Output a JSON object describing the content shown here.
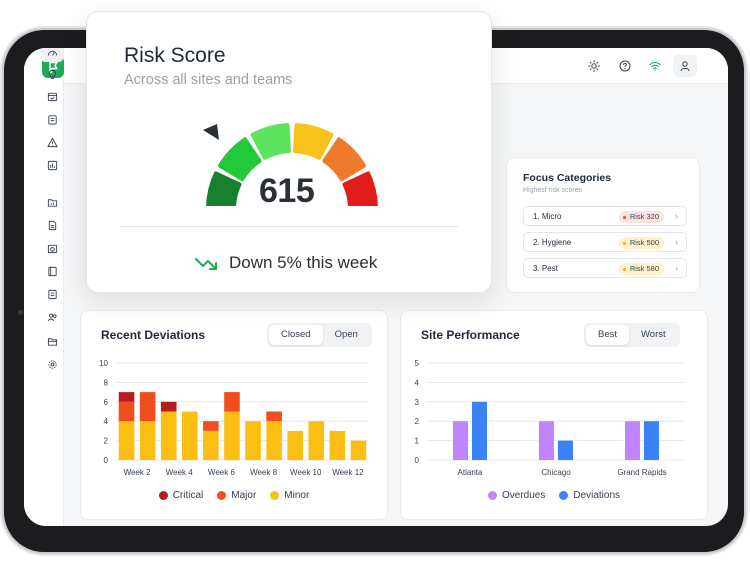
{
  "colors": {
    "brand": "#1faa58",
    "critical": "#b91c1c",
    "major": "#f04e1e",
    "minor": "#fbbf14",
    "overdues": "#c084fc",
    "deviations": "#3b82f6",
    "trend": "#1faa58",
    "gauge": [
      "#17812f",
      "#23c93a",
      "#5fe35f",
      "#f8c21c",
      "#f07a2b",
      "#e21b1b"
    ]
  },
  "sidebar": {
    "icons": [
      "gauge-icon",
      "lightbulb-icon",
      "calendar-check-icon",
      "clipboard-icon",
      "warning-icon",
      "bar-chart-icon",
      "folder-chart-icon",
      "document-icon",
      "calendar-clock-icon",
      "book-icon",
      "notes-icon",
      "users-icon",
      "folder-open-icon",
      "settings-icon"
    ]
  },
  "topbar": {
    "icons": [
      "sun-icon",
      "help-icon",
      "wifi-icon",
      "user-icon"
    ]
  },
  "risk": {
    "title": "Risk Score",
    "subtitle": "Across all sites and teams",
    "score": "615",
    "trend": "Down 5% this week"
  },
  "focus": {
    "title": "Focus Categories",
    "subtitle": "Highest risk scores",
    "items": [
      {
        "label": "1. Micro",
        "risk": "Risk 320",
        "level": "red"
      },
      {
        "label": "2. Hygiene",
        "risk": "Risk 500",
        "level": "yellow"
      },
      {
        "label": "3. Pest",
        "risk": "Risk 580",
        "level": "yellow"
      }
    ]
  },
  "deviations": {
    "title": "Recent Deviations",
    "toggle": [
      "Closed",
      "Open"
    ],
    "active_toggle": "Closed",
    "legend": [
      "Critical",
      "Major",
      "Minor"
    ]
  },
  "performance": {
    "title": "Site Performance",
    "toggle": [
      "Best",
      "Worst"
    ],
    "active_toggle": "Best",
    "legend": [
      "Overdues",
      "Deviations"
    ]
  },
  "chart_data": [
    {
      "type": "bar",
      "stacked": true,
      "title": "Recent Deviations",
      "categories": [
        "Week 1",
        "Week 2",
        "Week 3",
        "Week 4",
        "Week 5",
        "Week 6",
        "Week 7",
        "Week 8",
        "Week 9",
        "Week 10",
        "Week 11",
        "Week 12"
      ],
      "tick_labels_shown": [
        "Week 2",
        "Week 4",
        "Week 6",
        "Week 8",
        "Week 10",
        "Week 12"
      ],
      "series": [
        {
          "name": "Minor",
          "values": [
            4,
            4,
            5,
            5,
            3,
            5,
            4,
            4,
            3,
            4,
            3,
            2
          ]
        },
        {
          "name": "Major",
          "values": [
            2,
            3,
            0,
            0,
            1,
            2,
            0,
            1,
            0,
            0,
            0,
            0
          ]
        },
        {
          "name": "Critical",
          "values": [
            1,
            0,
            1,
            0,
            0,
            0,
            0,
            0,
            0,
            0,
            0,
            0
          ]
        }
      ],
      "ylim": [
        0,
        10
      ],
      "yticks": [
        0,
        2,
        4,
        6,
        8,
        10
      ],
      "grid": true,
      "legend": "bottom"
    },
    {
      "type": "bar",
      "title": "Site Performance",
      "categories": [
        "Atlanta",
        "Chicago",
        "Grand Rapids"
      ],
      "series": [
        {
          "name": "Overdues",
          "values": [
            2,
            2,
            2
          ]
        },
        {
          "name": "Deviations",
          "values": [
            3,
            1,
            2
          ]
        }
      ],
      "ylim": [
        0,
        5
      ],
      "yticks": [
        0,
        1,
        2,
        3,
        4,
        5
      ],
      "grid": true,
      "legend": "bottom"
    }
  ]
}
